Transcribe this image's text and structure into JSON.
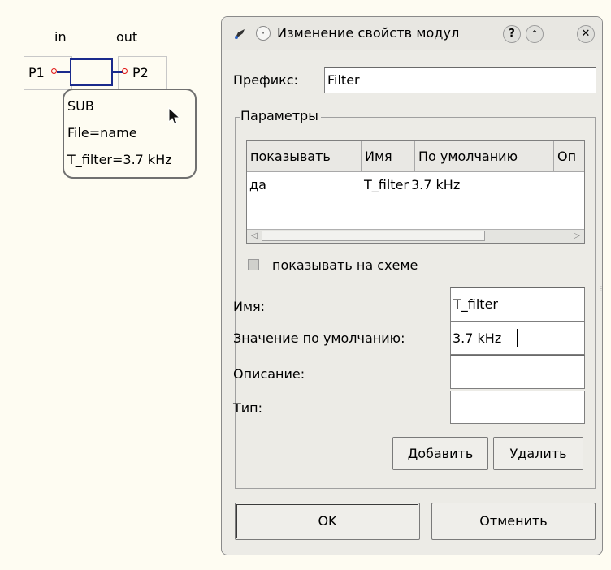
{
  "schematic": {
    "pin_in": "in",
    "pin_out": "out",
    "port1": "P1",
    "port2": "P2",
    "component_lines": [
      "SUB",
      "File=name",
      "T_filter=3.7 kHz"
    ]
  },
  "dialog": {
    "title": "Изменение свойств модул",
    "prefix_label": "Префикс:",
    "prefix_value": "Filter",
    "params_group_title": "Параметры",
    "table": {
      "columns": [
        "показывать",
        "Имя",
        "По умолчанию",
        "Оп"
      ],
      "rows": [
        [
          "да",
          "T_filter",
          "3.7 kHz"
        ]
      ]
    },
    "show_on_schematic_label": "показывать на схеме",
    "show_on_schematic_checked": false,
    "name_label": "Имя:",
    "name_value": "T_filter",
    "default_label": "Значение по умолчанию:",
    "default_value": "3.7 kHz",
    "description_label": "Описание:",
    "description_value": "",
    "type_label": "Тип:",
    "type_value": "",
    "add_button": "Добавить",
    "delete_button": "Удалить",
    "ok_button": "OK",
    "cancel_button": "Отменить"
  },
  "colors": {
    "canvas_bg": "#fefcf2",
    "wire": "#1a2a8c",
    "pin": "#e01010",
    "dialog_bg": "#ecebe6"
  }
}
